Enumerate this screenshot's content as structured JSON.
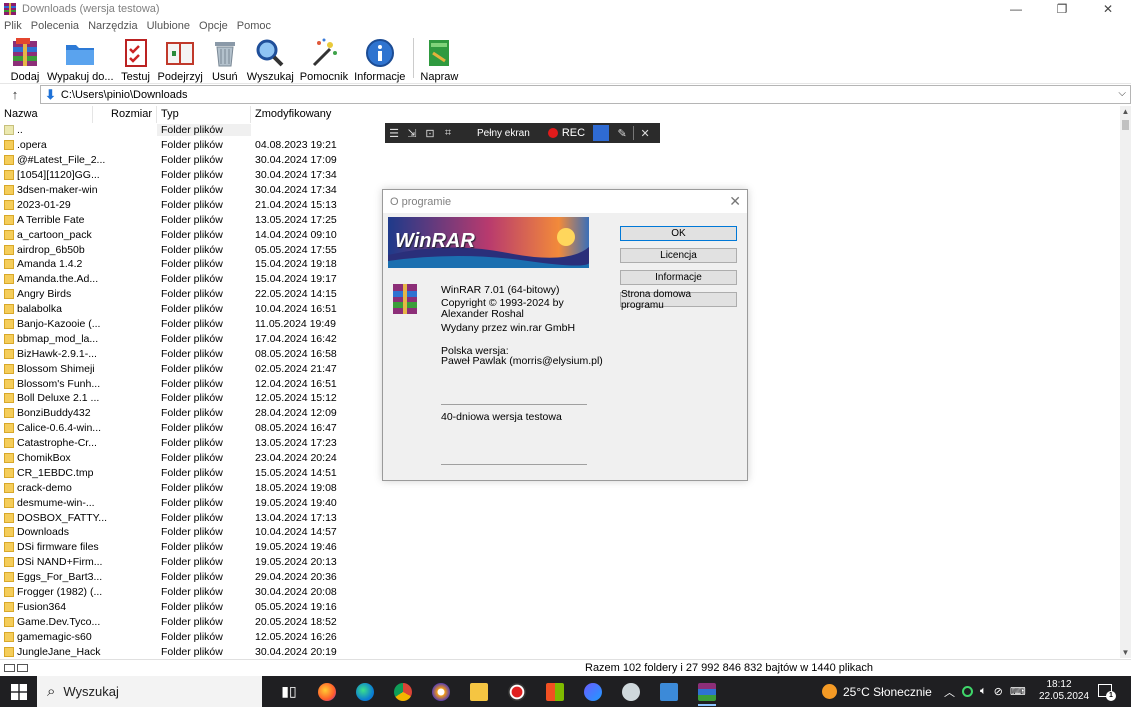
{
  "window": {
    "title": "Downloads (wersja testowa)"
  },
  "menu": [
    "Plik",
    "Polecenia",
    "Narzędzia",
    "Ulubione",
    "Opcje",
    "Pomoc"
  ],
  "toolbar": {
    "add": "Dodaj",
    "extract": "Wypakuj do...",
    "test": "Testuj",
    "view": "Podejrzyj",
    "delete": "Usuń",
    "find": "Wyszukaj",
    "wizard": "Pomocnik",
    "info": "Informacje",
    "repair": "Napraw"
  },
  "address": {
    "path": "C:\\Users\\pinio\\Downloads"
  },
  "columns": {
    "name": "Nazwa",
    "size": "Rozmiar",
    "type": "Typ",
    "modified": "Zmodyfikowany"
  },
  "files": [
    {
      "name": "..",
      "type": "Folder plików",
      "modified": ""
    },
    {
      "name": ".opera",
      "type": "Folder plików",
      "modified": "04.08.2023 19:21"
    },
    {
      "name": "@#Latest_File_2...",
      "type": "Folder plików",
      "modified": "30.04.2024 17:09"
    },
    {
      "name": "[1054][1120]GG...",
      "type": "Folder plików",
      "modified": "30.04.2024 17:34"
    },
    {
      "name": "3dsen-maker-win",
      "type": "Folder plików",
      "modified": "30.04.2024 17:34"
    },
    {
      "name": "2023-01-29",
      "type": "Folder plików",
      "modified": "21.04.2024 15:13"
    },
    {
      "name": "A Terrible Fate",
      "type": "Folder plików",
      "modified": "13.05.2024 17:25"
    },
    {
      "name": "a_cartoon_pack",
      "type": "Folder plików",
      "modified": "14.04.2024 09:10"
    },
    {
      "name": "airdrop_6b50b",
      "type": "Folder plików",
      "modified": "05.05.2024 17:55"
    },
    {
      "name": "Amanda 1.4.2",
      "type": "Folder plików",
      "modified": "15.04.2024 19:18"
    },
    {
      "name": "Amanda.the.Ad...",
      "type": "Folder plików",
      "modified": "15.04.2024 19:17"
    },
    {
      "name": "Angry Birds",
      "type": "Folder plików",
      "modified": "22.05.2024 14:15"
    },
    {
      "name": "balabolka",
      "type": "Folder plików",
      "modified": "10.04.2024 16:51"
    },
    {
      "name": "Banjo-Kazooie (...",
      "type": "Folder plików",
      "modified": "11.05.2024 19:49"
    },
    {
      "name": "bbmap_mod_la...",
      "type": "Folder plików",
      "modified": "17.04.2024 16:42"
    },
    {
      "name": "BizHawk-2.9.1-...",
      "type": "Folder plików",
      "modified": "08.05.2024 16:58"
    },
    {
      "name": "Blossom Shimeji",
      "type": "Folder plików",
      "modified": "02.05.2024 21:47"
    },
    {
      "name": "Blossom's Funh...",
      "type": "Folder plików",
      "modified": "12.04.2024 16:51"
    },
    {
      "name": "Boll Deluxe 2.1 ...",
      "type": "Folder plików",
      "modified": "12.05.2024 15:12"
    },
    {
      "name": "BonziBuddy432",
      "type": "Folder plików",
      "modified": "28.04.2024 12:09"
    },
    {
      "name": "Calice-0.6.4-win...",
      "type": "Folder plików",
      "modified": "08.05.2024 16:47"
    },
    {
      "name": "Catastrophe-Cr...",
      "type": "Folder plików",
      "modified": "13.05.2024 17:23"
    },
    {
      "name": "ChomikBox",
      "type": "Folder plików",
      "modified": "23.04.2024 20:24"
    },
    {
      "name": "CR_1EBDC.tmp",
      "type": "Folder plików",
      "modified": "15.05.2024 14:51"
    },
    {
      "name": "crack-demo",
      "type": "Folder plików",
      "modified": "18.05.2024 19:08"
    },
    {
      "name": "desmume-win-...",
      "type": "Folder plików",
      "modified": "19.05.2024 19:40"
    },
    {
      "name": "DOSBOX_FATTY...",
      "type": "Folder plików",
      "modified": "13.04.2024 17:13"
    },
    {
      "name": "Downloads",
      "type": "Folder plików",
      "modified": "10.04.2024 14:57"
    },
    {
      "name": "DSi firmware files",
      "type": "Folder plików",
      "modified": "19.05.2024 19:46"
    },
    {
      "name": "DSi NAND+Firm...",
      "type": "Folder plików",
      "modified": "19.05.2024 20:13"
    },
    {
      "name": "Eggs_For_Bart3...",
      "type": "Folder plików",
      "modified": "29.04.2024 20:36"
    },
    {
      "name": "Frogger (1982) (...",
      "type": "Folder plików",
      "modified": "30.04.2024 20:08"
    },
    {
      "name": "Fusion364",
      "type": "Folder plików",
      "modified": "05.05.2024 19:16"
    },
    {
      "name": "Game.Dev.Tyco...",
      "type": "Folder plików",
      "modified": "20.05.2024 18:52"
    },
    {
      "name": "gamemagic-s60",
      "type": "Folder plików",
      "modified": "12.05.2024 16:26"
    },
    {
      "name": "JungleJane_Hack",
      "type": "Folder plików",
      "modified": "30.04.2024 20:19"
    }
  ],
  "status": {
    "summary": "Razem 102 foldery i 27 992 846 832 bajtów w 1440 plikach"
  },
  "recorder": {
    "fullscreen": "Pełny ekran",
    "rec": "REC"
  },
  "about": {
    "title": "O programie",
    "banner": "WinRAR",
    "version": "WinRAR 7.01 (64-bitowy)",
    "copyright": "Copyright © 1993-2024 by",
    "author": "Alexander Roshal",
    "publisher": "Wydany przez win.rar GmbH",
    "polish_label": "Polska wersja:",
    "polish_translator": "Paweł Pawlak (morris@elysium.pl)",
    "trial": "40-dniowa wersja testowa",
    "buttons": {
      "ok": "OK",
      "license": "Licencja",
      "info": "Informacje",
      "homepage": "Strona domowa programu"
    }
  },
  "taskbar": {
    "search": "Wyszukaj",
    "weather": "25°C  Słonecznie",
    "time": "18:12",
    "date": "22.05.2024",
    "notifications": "1"
  }
}
